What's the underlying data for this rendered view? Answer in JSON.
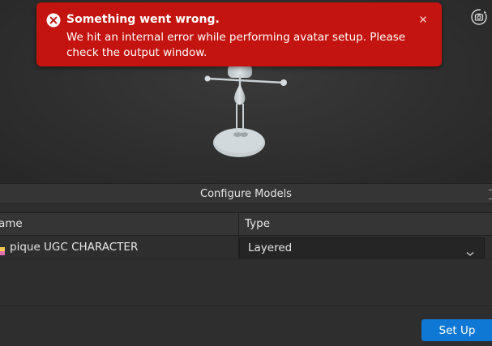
{
  "toast": {
    "title": "Something went wrong.",
    "message": "We hit an internal error while performing avatar setup. Please check the output window.",
    "icon": "error-circle-icon",
    "close_icon": "close-icon",
    "color": "#c3140f"
  },
  "viewport": {
    "camera_icon": "camera-rotate-icon"
  },
  "panel": {
    "title": "Configure Models",
    "columns": [
      "ame",
      "Type"
    ],
    "rows": [
      {
        "name": "pique UGC CHARACTER",
        "type": "Layered",
        "icon": "model-icon"
      }
    ],
    "setup_label": "Set Up",
    "accent_color": "#0f78d4"
  }
}
